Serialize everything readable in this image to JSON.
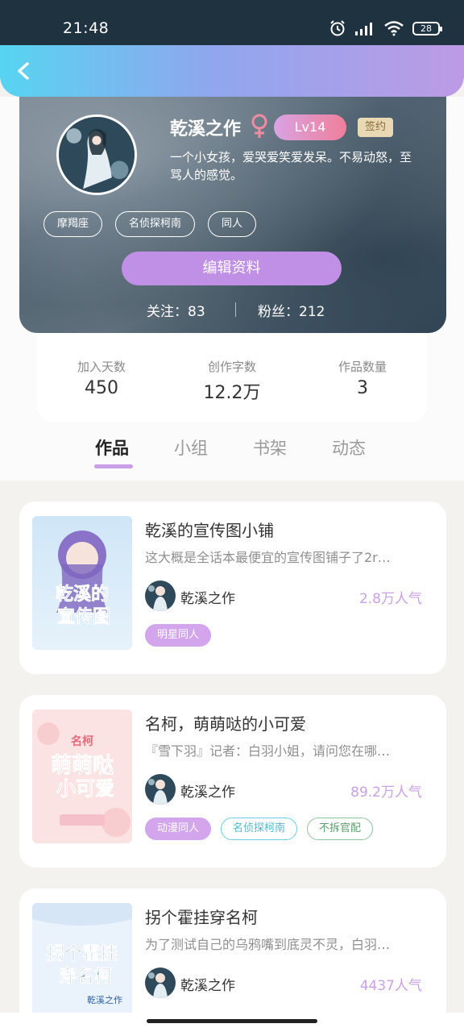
{
  "status_bar": {
    "time": "21:48",
    "battery": "28"
  },
  "profile": {
    "username": "乾溪之作",
    "level": "Lv14",
    "signed": "签约",
    "bio_line1": "一个小女孩，爱哭爱笑爱发呆。不易动怒，至",
    "bio_line2": "骂人的感觉。",
    "tags": [
      "摩羯座",
      "名侦探柯南",
      "同人"
    ],
    "edit_label": "编辑资料",
    "follow_text": "关注：83",
    "fans_text": "粉丝：212"
  },
  "stats": [
    {
      "label": "加入天数",
      "value": "450"
    },
    {
      "label": "创作字数",
      "value": "12.2万"
    },
    {
      "label": "作品数量",
      "value": "3"
    }
  ],
  "tabs": [
    "作品",
    "小组",
    "书架",
    "动态"
  ],
  "books": [
    {
      "title": "乾溪的宣传图小铺",
      "desc": "这大概是全话本最便宜的宣传图铺子了2r…",
      "author": "乾溪之作",
      "popularity": "2.8万人气",
      "tags": [
        "明星同人"
      ]
    },
    {
      "title": "名柯，萌萌哒的小可爱",
      "desc": "『雪下羽』记者：白羽小姐，请问您在哪…",
      "author": "乾溪之作",
      "popularity": "89.2万人气",
      "tags": [
        "动漫同人",
        "名侦探柯南",
        "不拆官配"
      ]
    },
    {
      "title": "拐个霍挂穿名柯",
      "desc": "为了测试自己的乌鸦嘴到底灵不灵，白羽…",
      "author": "乾溪之作",
      "popularity": "4437人气",
      "tags": []
    }
  ],
  "covers": {
    "book1_line1": "乾溪的",
    "book1_line2": "宣传图",
    "book2_top": "名柯",
    "book2_line1": "萌萌哒",
    "book2_line2": "小可爱",
    "book3_line1": "拐个霍挂",
    "book3_line2": "穿名柯",
    "book3_sign": "乾溪之作"
  },
  "colors": {
    "accent": "#c08fe6",
    "popularity": "#c8a1e6"
  }
}
